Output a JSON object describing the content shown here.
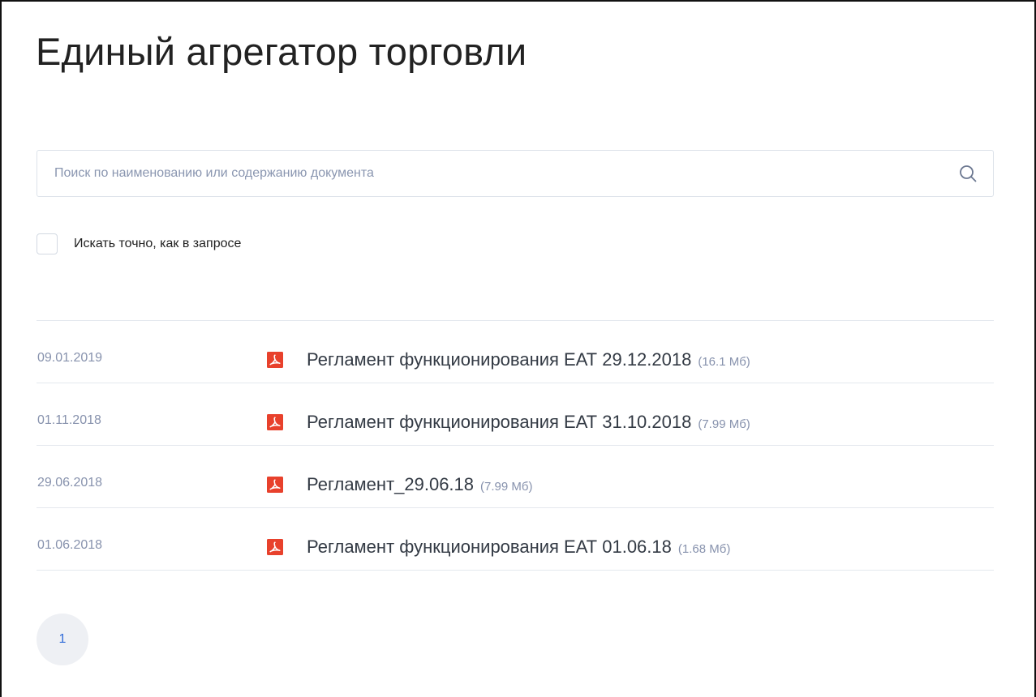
{
  "page": {
    "title": "Единый агрегатор торговли"
  },
  "search": {
    "placeholder": "Поиск по наименованию или содержанию документа",
    "value": "",
    "icon": "search-icon"
  },
  "exact_match": {
    "label": "Искать точно, как в запросе",
    "checked": false
  },
  "documents": [
    {
      "date": "09.01.2019",
      "title": "Регламент функционирования ЕАТ 29.12.2018",
      "size": "(16.1 Мб)",
      "icon": "pdf-icon"
    },
    {
      "date": "01.11.2018",
      "title": "Регламент функционирования ЕАТ 31.10.2018",
      "size": "(7.99 Мб)",
      "icon": "pdf-icon"
    },
    {
      "date": "29.06.2018",
      "title": "Регламент_29.06.18",
      "size": "(7.99 Мб)",
      "icon": "pdf-icon"
    },
    {
      "date": "01.06.2018",
      "title": "Регламент функционирования ЕАТ 01.06.18",
      "size": "(1.68 Мб)",
      "icon": "pdf-icon"
    }
  ],
  "pagination": {
    "current": "1"
  },
  "colors": {
    "pdf_icon": "#e8412c",
    "accent": "#2f6bd8",
    "muted_text": "#8792ad"
  }
}
